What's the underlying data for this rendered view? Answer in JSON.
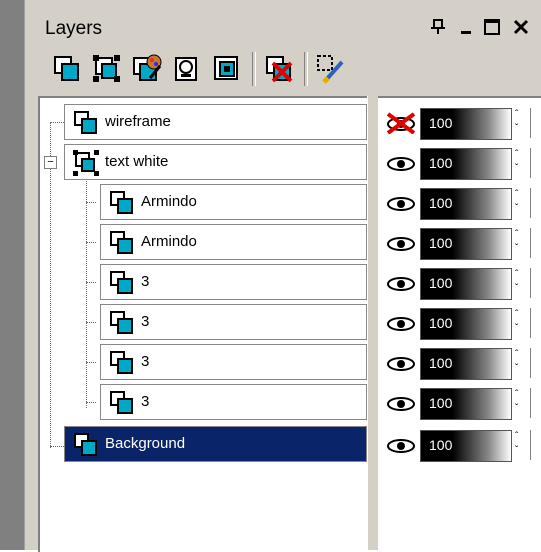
{
  "panel": {
    "title": "Layers",
    "title_buttons": [
      "pin-icon",
      "minimize-icon",
      "maximize-icon",
      "close-icon"
    ]
  },
  "toolbar": {
    "tools": [
      "new-raster-layer-icon",
      "new-vector-layer-icon",
      "new-art-media-layer-icon",
      "new-mask-layer-icon",
      "new-adjustment-layer-icon",
      "delete-layer-icon",
      "edit-selection-icon"
    ]
  },
  "layers": [
    {
      "name": "wireframe",
      "visible": false,
      "opacity": "100",
      "depth": 0,
      "group": false,
      "selected": false
    },
    {
      "name": "text white",
      "visible": true,
      "opacity": "100",
      "depth": 0,
      "group": true,
      "selected": false
    },
    {
      "name": "Armindo",
      "visible": true,
      "opacity": "100",
      "depth": 1,
      "group": false,
      "selected": false
    },
    {
      "name": "Armindo",
      "visible": true,
      "opacity": "100",
      "depth": 1,
      "group": false,
      "selected": false
    },
    {
      "name": "3",
      "visible": true,
      "opacity": "100",
      "depth": 1,
      "group": false,
      "selected": false
    },
    {
      "name": "3",
      "visible": true,
      "opacity": "100",
      "depth": 1,
      "group": false,
      "selected": false
    },
    {
      "name": "3",
      "visible": true,
      "opacity": "100",
      "depth": 1,
      "group": false,
      "selected": false
    },
    {
      "name": "3",
      "visible": true,
      "opacity": "100",
      "depth": 1,
      "group": false,
      "selected": false
    },
    {
      "name": "Background",
      "visible": true,
      "opacity": "100",
      "depth": 0,
      "group": false,
      "selected": true
    }
  ],
  "colors": {
    "selection": "#0a246a",
    "panel_bg": "#d4d0c8",
    "layer_icon": "#00a8c8"
  }
}
